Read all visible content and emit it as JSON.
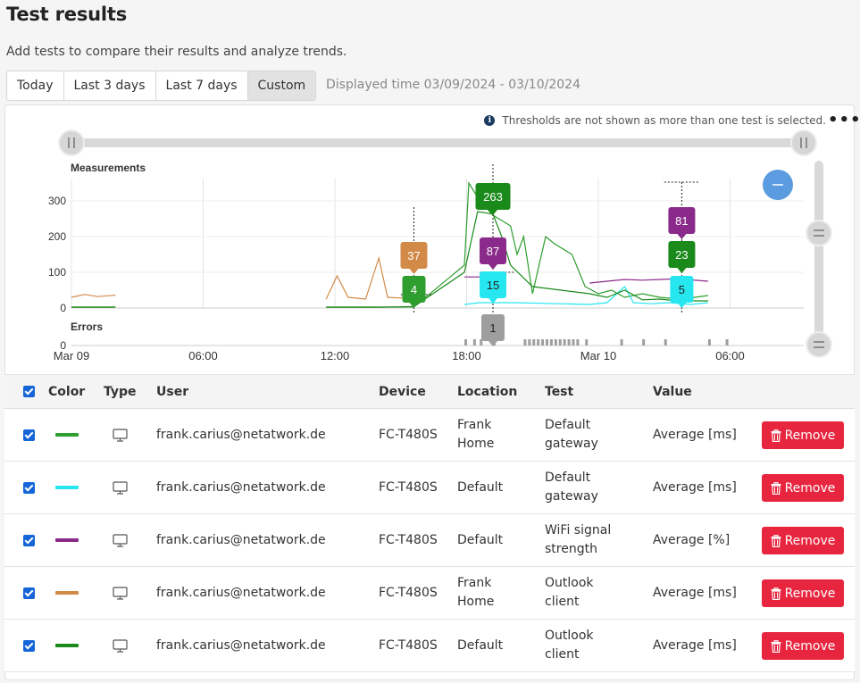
{
  "page": {
    "title": "Test results",
    "subtitle": "Add tests to compare their results and analyze trends.",
    "range_tabs": [
      "Today",
      "Last 3 days",
      "Last 7 days",
      "Custom"
    ],
    "active_tab": "Custom",
    "displayed_time": "Displayed time 03/09/2024 - 03/10/2024"
  },
  "chart_panel": {
    "threshold_note": "Thresholds are not shown as more than one test is selected.",
    "more_icon": "more-horizontal-icon",
    "zoom_icon": "minus-icon"
  },
  "chart_data": {
    "type": "line",
    "panels": {
      "measurements": {
        "title": "Measurements",
        "y_ticks": [
          "300",
          "200",
          "100",
          "0"
        ],
        "ylim": [
          0,
          360
        ]
      },
      "errors": {
        "title": "Errors",
        "y_ticks": [
          "0"
        ]
      }
    },
    "x_ticks": [
      "Mar 09",
      "06:00",
      "12:00",
      "18:00",
      "Mar 10",
      "06:00"
    ],
    "series": [
      {
        "color": "#2e9e2e",
        "points": [
          [
            0.0,
            3
          ],
          [
            2.0,
            3
          ],
          [
            11.6,
            3
          ],
          [
            15.6,
            3
          ],
          [
            17.9,
            120
          ],
          [
            18.1,
            350
          ],
          [
            18.6,
            300
          ],
          [
            19.2,
            260
          ],
          [
            20.0,
            230
          ],
          [
            20.3,
            150
          ],
          [
            20.6,
            200
          ],
          [
            21.0,
            40
          ],
          [
            21.6,
            200
          ],
          [
            22.0,
            180
          ],
          [
            22.8,
            150
          ],
          [
            23.4,
            60
          ],
          [
            24.0,
            40
          ],
          [
            24.6,
            50
          ],
          [
            25.2,
            30
          ],
          [
            26.0,
            40
          ],
          [
            26.8,
            30
          ],
          [
            27.8,
            25
          ],
          [
            29.0,
            35
          ]
        ]
      },
      {
        "color": "#26e6f0",
        "points": [
          [
            17.9,
            10
          ],
          [
            18.6,
            15
          ],
          [
            19.4,
            15
          ],
          [
            20.2,
            15
          ],
          [
            23.6,
            10
          ],
          [
            24.4,
            15
          ],
          [
            25.2,
            60
          ],
          [
            25.6,
            15
          ],
          [
            26.4,
            12
          ],
          [
            27.2,
            15
          ],
          [
            28.2,
            10
          ],
          [
            29.0,
            15
          ]
        ]
      },
      {
        "color": "#8a2a8a",
        "points": [
          [
            17.9,
            87
          ],
          [
            18.8,
            87
          ],
          [
            19.4,
            87
          ],
          [
            23.6,
            70
          ],
          [
            24.4,
            75
          ],
          [
            25.2,
            80
          ],
          [
            26.0,
            78
          ],
          [
            26.8,
            80
          ],
          [
            27.6,
            82
          ],
          [
            29.0,
            75
          ]
        ]
      },
      {
        "color": "#d28a48",
        "points": [
          [
            0.0,
            30
          ],
          [
            0.6,
            38
          ],
          [
            1.2,
            32
          ],
          [
            2.0,
            36
          ],
          [
            11.6,
            25
          ],
          [
            12.1,
            90
          ],
          [
            12.6,
            30
          ],
          [
            13.4,
            25
          ],
          [
            14.0,
            140
          ],
          [
            14.4,
            30
          ],
          [
            15.0,
            28
          ],
          [
            15.6,
            37
          ]
        ]
      },
      {
        "color": "#1a8a1a",
        "points": [
          [
            0.0,
            2
          ],
          [
            1.0,
            2
          ],
          [
            2.0,
            2
          ],
          [
            11.6,
            2
          ],
          [
            14.0,
            2
          ],
          [
            15.6,
            4
          ],
          [
            17.9,
            100
          ],
          [
            18.5,
            270
          ],
          [
            19.2,
            263
          ],
          [
            19.6,
            200
          ],
          [
            20.0,
            120
          ],
          [
            21.0,
            60
          ],
          [
            23.6,
            40
          ],
          [
            24.4,
            30
          ],
          [
            25.2,
            50
          ],
          [
            26.0,
            23
          ],
          [
            26.8,
            25
          ],
          [
            27.6,
            20
          ],
          [
            29.0,
            20
          ]
        ]
      }
    ],
    "tooltips": [
      {
        "label": "37",
        "color": "#d28a48"
      },
      {
        "label": "4",
        "color": "#2e9e2e"
      },
      {
        "label": "263",
        "color": "#1a8a1a"
      },
      {
        "label": "87",
        "color": "#8a2a8a"
      },
      {
        "label": "15",
        "color": "#26e6f0"
      },
      {
        "label": "1",
        "color": "#9e9e9e"
      },
      {
        "label": "81",
        "color": "#8a2a8a"
      },
      {
        "label": "23",
        "color": "#1a8a1a"
      },
      {
        "label": "5",
        "color": "#26e6f0"
      }
    ]
  },
  "table": {
    "headers": {
      "color": "Color",
      "type": "Type",
      "user": "User",
      "device": "Device",
      "location": "Location",
      "test": "Test",
      "value": "Value"
    },
    "remove_label": "Remove",
    "rows": [
      {
        "color": "#2e9e2e",
        "user": "frank.carius@netatwork.de",
        "device": "FC-T480S",
        "location": "Frank\nHome",
        "test": "Default\ngateway",
        "value": "Average [ms]"
      },
      {
        "color": "#26e6f0",
        "user": "frank.carius@netatwork.de",
        "device": "FC-T480S",
        "location": "Default",
        "test": "Default\ngateway",
        "value": "Average [ms]"
      },
      {
        "color": "#8a2a8a",
        "user": "frank.carius@netatwork.de",
        "device": "FC-T480S",
        "location": "Default",
        "test": "WiFi signal\nstrength",
        "value": "Average [%]"
      },
      {
        "color": "#d28a48",
        "user": "frank.carius@netatwork.de",
        "device": "FC-T480S",
        "location": "Frank\nHome",
        "test": "Outlook\nclient",
        "value": "Average [ms]"
      },
      {
        "color": "#1a8a1a",
        "user": "frank.carius@netatwork.de",
        "device": "FC-T480S",
        "location": "Default",
        "test": "Outlook\nclient",
        "value": "Average [ms]"
      }
    ]
  }
}
